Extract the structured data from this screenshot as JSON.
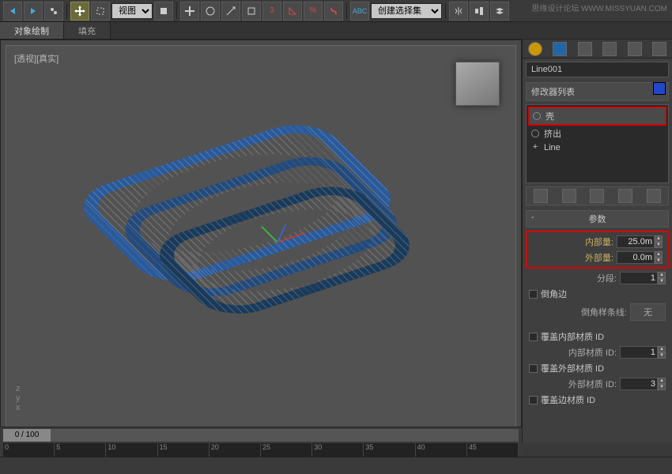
{
  "watermark": "思缘设计论坛 WWW.MISSYUAN.COM",
  "toolbar": {
    "view_dropdown": "视图",
    "selection_set_dropdown": "创建选择集"
  },
  "tabs": {
    "object_paint": "对象绘制",
    "fill": "填充"
  },
  "viewport": {
    "label": "[透视][真实]"
  },
  "axis": {
    "x": "x",
    "y": "y",
    "z": "z"
  },
  "panel": {
    "object_name": "Line001",
    "modifier_list_label": "修改器列表",
    "modifiers": {
      "shell": "壳",
      "extrude": "挤出",
      "line": "Line"
    },
    "rollout_params": "参数",
    "inner_amount_label": "内部量:",
    "inner_amount_value": "25.0m",
    "outer_amount_label": "外部量:",
    "outer_amount_value": "0.0m",
    "segments_label": "分段:",
    "segments_value": "1",
    "bevel_edges": "倒角边",
    "bevel_spline_label": "倒角样条线:",
    "bevel_spline_btn": "无",
    "override_inner_mat": "覆盖内部材质 ID",
    "inner_mat_id_label": "内部材质 ID:",
    "inner_mat_id_value": "1",
    "override_outer_mat": "覆盖外部材质 ID",
    "outer_mat_id_label": "外部材质 ID:",
    "outer_mat_id_value": "3",
    "override_edge_mat": "覆盖边材质 ID"
  },
  "timeline": {
    "position": "0 / 100",
    "ticks": [
      "0",
      "5",
      "10",
      "15",
      "20",
      "25",
      "30",
      "35",
      "40",
      "45"
    ]
  }
}
